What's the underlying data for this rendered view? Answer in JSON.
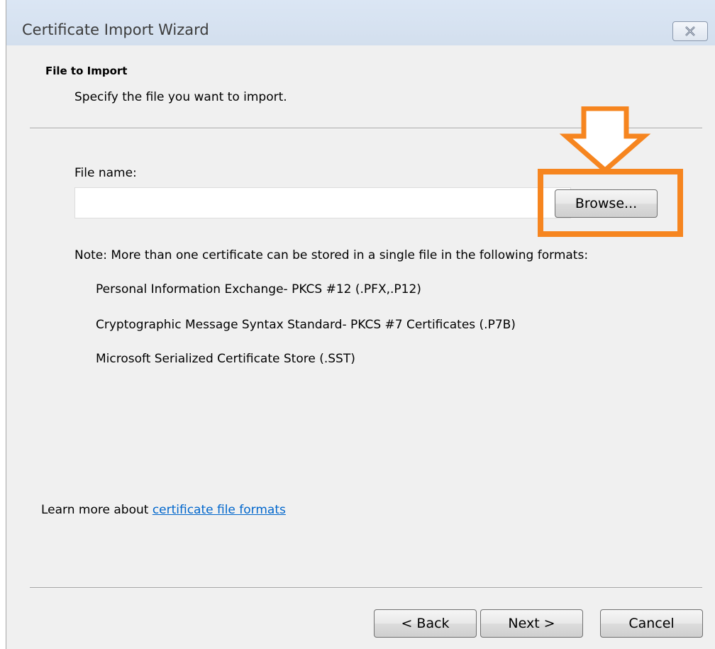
{
  "window": {
    "title": "Certificate Import Wizard"
  },
  "header": {
    "section_title": "File to Import",
    "section_subtitle": "Specify the file you want to import."
  },
  "file_field": {
    "label": "File name:",
    "value": "",
    "browse_label": "Browse..."
  },
  "note": {
    "text": "Note:  More than one certificate can be stored in a single file in the following formats:",
    "formats": [
      "Personal Information Exchange- PKCS #12 (.PFX,.P12)",
      "Cryptographic Message Syntax Standard- PKCS #7 Certificates (.P7B)",
      "Microsoft Serialized Certificate Store (.SST)"
    ]
  },
  "learn_more": {
    "prefix": "Learn more about ",
    "link_text": "certificate file formats"
  },
  "footer": {
    "back_label": "< Back",
    "next_label": "Next >",
    "cancel_label": "Cancel"
  },
  "annotation": {
    "color": "#f6851f",
    "icon": "down-arrow-icon"
  },
  "colors": {
    "link": "#0066cc",
    "dialog_background": "#f0f0f0",
    "titlebar": "#d3dfee"
  }
}
